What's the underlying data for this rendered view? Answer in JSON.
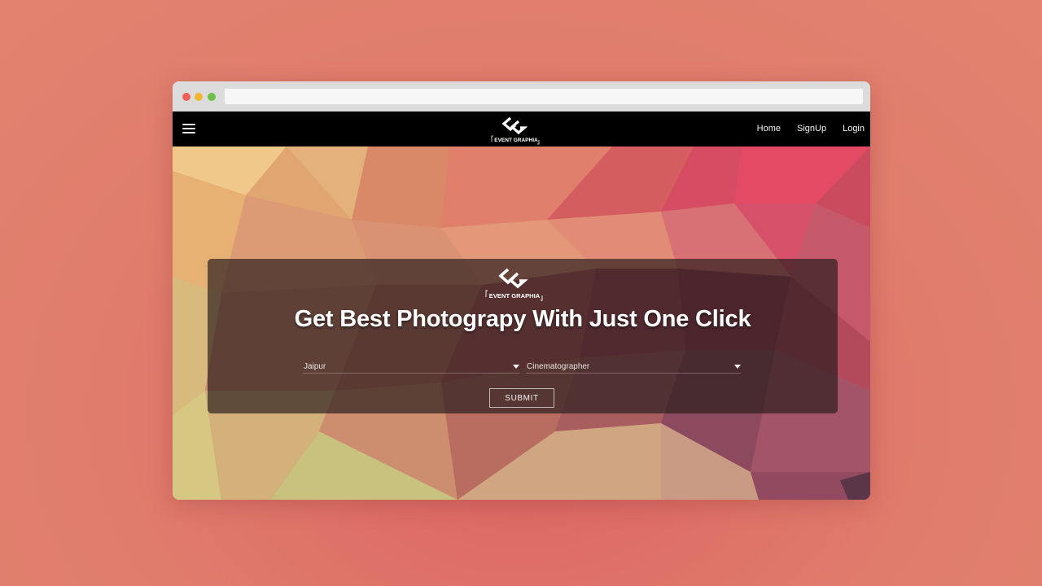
{
  "nav": {
    "links": [
      {
        "label": "Home"
      },
      {
        "label": "SignUp"
      },
      {
        "label": "Login"
      }
    ],
    "logo_text": "EVENT GRAPHIA"
  },
  "hero": {
    "logo_text": "EVENT GRAPHIA",
    "headline": "Get Best Photograpy With Just One Click",
    "city_select": {
      "value": "Jaipur"
    },
    "role_select": {
      "value": "Cinematographer"
    },
    "submit_label": "SUBMIT"
  },
  "colors": {
    "page_background": "#e07c6c",
    "navbar": "#000000",
    "panel": "rgba(40,28,28,0.68)"
  }
}
